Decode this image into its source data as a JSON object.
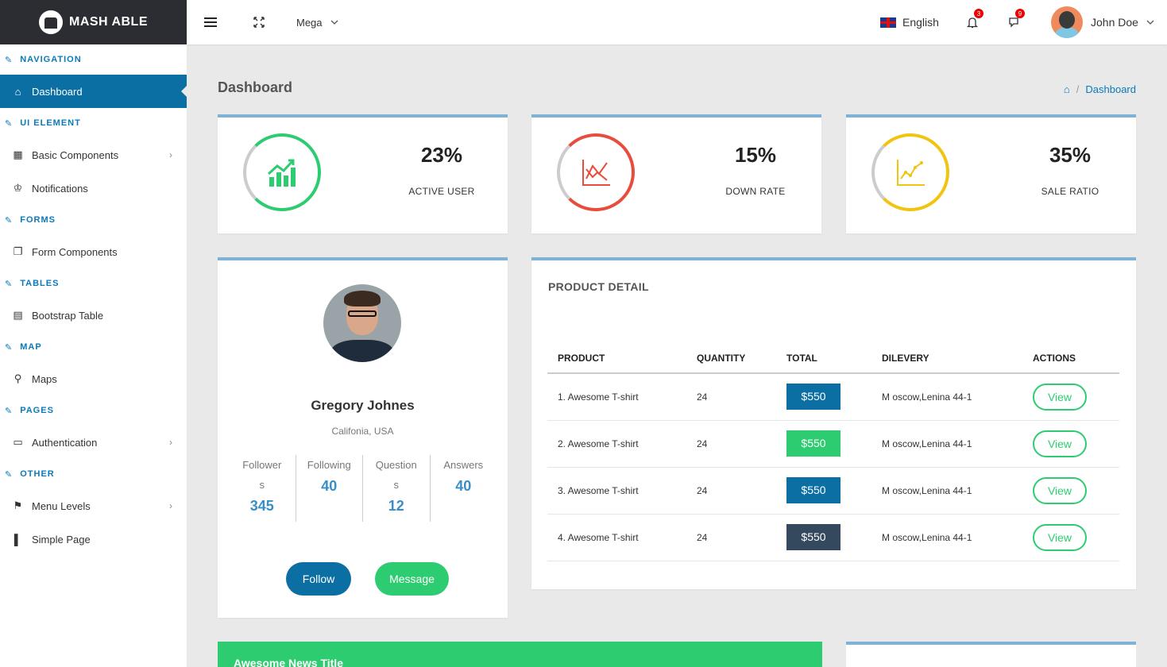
{
  "brand": {
    "name": "MASH ABLE"
  },
  "header": {
    "mega_label": "Mega",
    "language": "English",
    "notifications_count": "3",
    "messages_count": "9",
    "user_name": "John Doe"
  },
  "sidebar": {
    "sections": [
      {
        "title": "NAVIGATION",
        "items": [
          {
            "label": "Dashboard",
            "icon": "home-icon",
            "active": true
          }
        ]
      },
      {
        "title": "UI ELEMENT",
        "items": [
          {
            "label": "Basic Components",
            "icon": "grid-icon",
            "chevron": true
          },
          {
            "label": "Notifications",
            "icon": "crown-icon"
          }
        ]
      },
      {
        "title": "FORMS",
        "items": [
          {
            "label": "Form Components",
            "icon": "form-icon"
          }
        ]
      },
      {
        "title": "TABLES",
        "items": [
          {
            "label": "Bootstrap Table",
            "icon": "table-icon"
          }
        ]
      },
      {
        "title": "MAP",
        "items": [
          {
            "label": "Maps",
            "icon": "map-icon"
          }
        ]
      },
      {
        "title": "PAGES",
        "items": [
          {
            "label": "Authentication",
            "icon": "id-card-icon",
            "chevron": true
          }
        ]
      },
      {
        "title": "OTHER",
        "items": [
          {
            "label": "Menu Levels",
            "icon": "signpost-icon",
            "chevron": true
          },
          {
            "label": "Simple Page",
            "icon": "page-icon"
          }
        ]
      }
    ]
  },
  "page": {
    "title": "Dashboard",
    "breadcrumb": "Dashboard"
  },
  "stats": [
    {
      "value": "23%",
      "label": "ACTIVE USER",
      "color": "#2ecc71"
    },
    {
      "value": "15%",
      "label": "DOWN RATE",
      "color": "#e74c3c"
    },
    {
      "value": "35%",
      "label": "SALE RATIO",
      "color": "#f1c40f"
    }
  ],
  "profile": {
    "name": "Gregory Johnes",
    "location": "Califonia, USA",
    "stats": [
      {
        "label": "Followers",
        "value": "345"
      },
      {
        "label": "Following",
        "value": "40"
      },
      {
        "label": "Questions",
        "value": "12"
      },
      {
        "label": "Answers",
        "value": "40"
      }
    ],
    "follow_label": "Follow",
    "message_label": "Message"
  },
  "product_detail": {
    "title": "PRODUCT DETAIL",
    "columns": [
      "PRODUCT",
      "QUANTITY",
      "TOTAL",
      "DILEVERY",
      "ACTIONS"
    ],
    "rows": [
      {
        "product": "1. Awesome T-shirt",
        "quantity": "24",
        "total": "$550",
        "total_color": "#0b6fa4",
        "delivery": "M oscow,Lenina 44-1",
        "action": "View"
      },
      {
        "product": "2. Awesome T-shirt",
        "quantity": "24",
        "total": "$550",
        "total_color": "#2ecc71",
        "delivery": "M oscow,Lenina 44-1",
        "action": "View"
      },
      {
        "product": "3. Awesome T-shirt",
        "quantity": "24",
        "total": "$550",
        "total_color": "#0b6fa4",
        "delivery": "M oscow,Lenina 44-1",
        "action": "View"
      },
      {
        "product": "4. Awesome T-shirt",
        "quantity": "24",
        "total": "$550",
        "total_color": "#34495e",
        "delivery": "M oscow,Lenina 44-1",
        "action": "View"
      }
    ]
  },
  "news": {
    "title": "Awesome News Title"
  }
}
